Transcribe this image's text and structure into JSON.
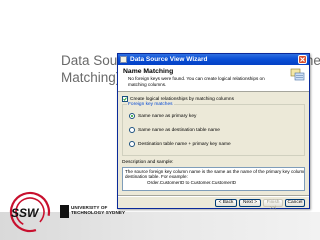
{
  "slide": {
    "title_line1": "Data Source View – Connect Tables (Name",
    "title_line2": "Matching)"
  },
  "logos": {
    "uts_line1": "UNIVERSITY OF",
    "uts_line2": "TECHNOLOGY SYDNEY"
  },
  "dialog": {
    "window_title": "Data Source View Wizard",
    "header_title": "Name Matching",
    "header_description": "No foreign keys were found. You can create logical relationships on matching columns.",
    "create_checkbox_label": "Create logical relationships by matching columns",
    "create_checkbox_checked": true,
    "foreign_key_legend": "Foreign key matches",
    "options": [
      {
        "label": "Same name as primary key",
        "checked": true
      },
      {
        "label": "Same name as destination table name",
        "checked": false
      },
      {
        "label": "Destination table name + primary key name",
        "checked": false
      }
    ],
    "description_label": "Description and sample:",
    "description_line1": "The source foreign key column name is the same as the name of the primary key column on the",
    "description_line2": "destination table. For example:",
    "description_example": "Order.CustomerID to Customer.CustomerID",
    "buttons": {
      "back": "< Back",
      "next": "Next >",
      "finish": "Finish >>|",
      "cancel": "Cancel"
    }
  }
}
